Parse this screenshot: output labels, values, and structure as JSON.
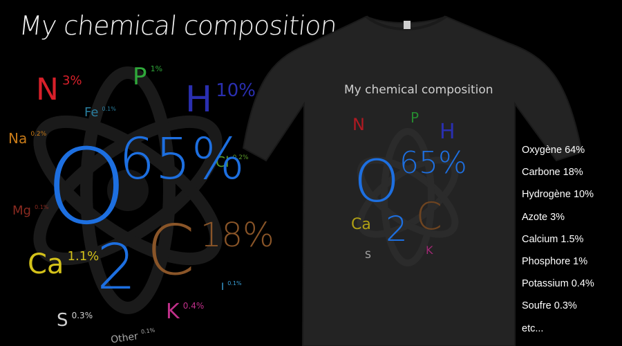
{
  "artwork": {
    "title": "My chemical composition",
    "elements": [
      {
        "key": "n",
        "symbol": "N",
        "value": "3%",
        "color": "#d8202a"
      },
      {
        "key": "p",
        "symbol": "P",
        "value": "1%",
        "color": "#2fa83a"
      },
      {
        "key": "h",
        "symbol": "H",
        "value": "10%",
        "color": "#2a2fb0"
      },
      {
        "key": "fe",
        "symbol": "Fe",
        "value": "0.1%",
        "color": "#2a7fa0"
      },
      {
        "key": "na",
        "symbol": "Na",
        "value": "0.2%",
        "color": "#c77a18"
      },
      {
        "key": "cl",
        "symbol": "Cl",
        "value": "0.2%",
        "color": "#5a9a2a"
      },
      {
        "key": "o",
        "symbol": "O",
        "value": "65%",
        "color": "#1d6fe0"
      },
      {
        "key": "mg",
        "symbol": "Mg",
        "value": "0.1%",
        "color": "#8a2a20"
      },
      {
        "key": "c",
        "symbol": "C",
        "value": "18%",
        "color": "#8a5528"
      },
      {
        "key": "ca",
        "symbol": "Ca",
        "value": "1.1%",
        "color": "#d4c21a"
      },
      {
        "key": "two",
        "symbol": "2",
        "value": "",
        "color": "#1d6fe0"
      },
      {
        "key": "i",
        "symbol": "I",
        "value": "0.1%",
        "color": "#3aa0d8"
      },
      {
        "key": "k",
        "symbol": "K",
        "value": "0.4%",
        "color": "#c0308a"
      },
      {
        "key": "s",
        "symbol": "S",
        "value": "0.3%",
        "color": "#cfcfcf"
      },
      {
        "key": "other",
        "symbol": "Other",
        "value": "0.1%",
        "color": "#aaaaaa"
      }
    ]
  },
  "tshirt": {
    "print_title": "My chemical composition",
    "shirt_color": "#232323"
  },
  "legend": {
    "items": [
      "Oxygène 64%",
      "Carbone 18%",
      "Hydrogène 10%",
      "Azote 3%",
      "Calcium 1.5%",
      "Phosphore 1%",
      "Potassium 0.4%",
      "Soufre 0.3%",
      "etc..."
    ]
  }
}
